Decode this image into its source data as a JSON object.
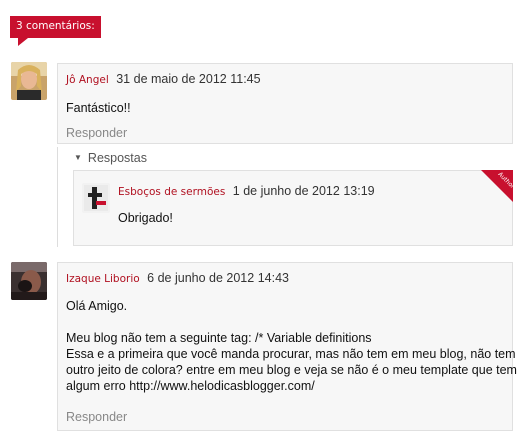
{
  "comments_count_label": "3 comentários:",
  "comments": [
    {
      "author": "Jô Angel",
      "date": "31 de maio de 2012 11:45",
      "text": "Fantástico!!",
      "reply_label": "Responder"
    },
    {
      "author": "Izaque Liborio",
      "date": "6 de junho de 2012 14:43",
      "text_lines": [
        "Olá Amigo.",
        "",
        "Meu blog não tem a seguinte tag: /* Variable definitions",
        "Essa e a primeira que você manda procurar, mas não tem em meu blog, não tem",
        "outro jeito de colora? entre em meu blog e veja se não é o meu template que tem",
        "algum erro http://www.helodicasblogger.com/"
      ],
      "reply_label": "Responder"
    }
  ],
  "replies_toggle_label": "Respostas",
  "reply": {
    "author": "Esboços de sermões",
    "date": "1 de junho de 2012 13:19",
    "text": "Obrigado!",
    "badge": "Author"
  },
  "icons": {
    "replies_toggle": "caret-down-icon"
  },
  "colors": {
    "accent": "#c8102e",
    "author_name": "#b01020",
    "box_bg": "#f7f7f7",
    "box_border": "#e0e0e0"
  }
}
